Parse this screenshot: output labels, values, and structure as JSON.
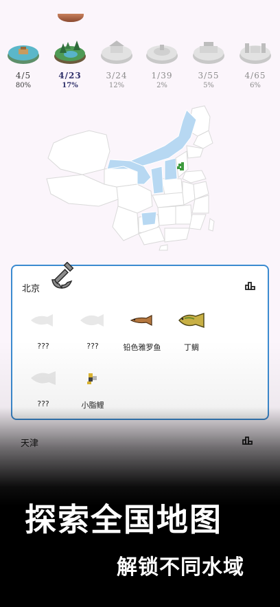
{
  "regions": [
    {
      "count": "4/5",
      "percent": "80%",
      "state": "unlocked",
      "icon": "lake-island-icon"
    },
    {
      "count": "4/23",
      "percent": "17%",
      "state": "active",
      "icon": "forest-lake-icon"
    },
    {
      "count": "3/24",
      "percent": "12%",
      "state": "locked",
      "icon": "locked-region-icon"
    },
    {
      "count": "1/39",
      "percent": "2%",
      "state": "locked",
      "icon": "locked-region-icon"
    },
    {
      "count": "3/55",
      "percent": "5%",
      "state": "locked",
      "icon": "locked-region-icon"
    },
    {
      "count": "4/65",
      "percent": "6%",
      "state": "locked",
      "icon": "locked-region-icon"
    }
  ],
  "map": {
    "highlight_color": "#b7d8f2",
    "marker_color": "#3d9a3d"
  },
  "card": {
    "province": "北京",
    "fish": [
      {
        "name": "???",
        "state": "unknown"
      },
      {
        "name": "???",
        "state": "unknown"
      },
      {
        "name": "铅色雅罗鱼",
        "state": "caught"
      },
      {
        "name": "丁鲷",
        "state": "caught"
      },
      {
        "name": "???",
        "state": "unknown"
      },
      {
        "name": "小脂鲤",
        "state": "caught"
      }
    ],
    "border_color": "#3a8ad0"
  },
  "next_province": {
    "name": "天津"
  },
  "banner": {
    "title": "探索全国地图",
    "subtitle": "解锁不同水域"
  }
}
